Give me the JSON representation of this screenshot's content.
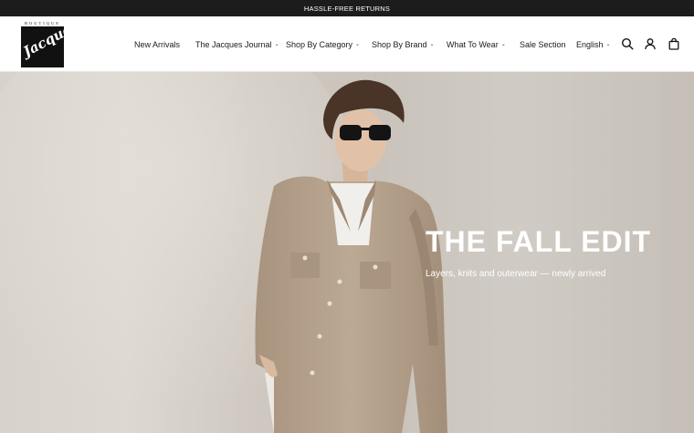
{
  "announcement": {
    "text": "HASSLE-FREE RETURNS"
  },
  "logo": {
    "top_text": "BOUTIQUE",
    "script_text": "Jacques"
  },
  "nav": {
    "items": [
      {
        "label": "New Arrivals",
        "dropdown": false
      },
      {
        "label": "The Jacques Journal",
        "dropdown": true
      },
      {
        "label": "Shop By Category",
        "dropdown": true
      },
      {
        "label": "Shop By Brand",
        "dropdown": true
      },
      {
        "label": "What To Wear",
        "dropdown": true
      },
      {
        "label": "Sale Section",
        "dropdown": false
      }
    ],
    "language": "English"
  },
  "icons": {
    "search": "search-icon",
    "account": "account-icon",
    "cart": "bag-icon",
    "caret": "chevron-down-icon"
  },
  "hero": {
    "title": "THE FALL EDIT",
    "subtitle": "Layers, knits and outerwear — newly arrived"
  },
  "colors": {
    "announcement_bg": "#1c1c1c",
    "hero_bg": "#d3cec7",
    "jacket": "#b5a28d",
    "hero_text": "#ffffff"
  }
}
